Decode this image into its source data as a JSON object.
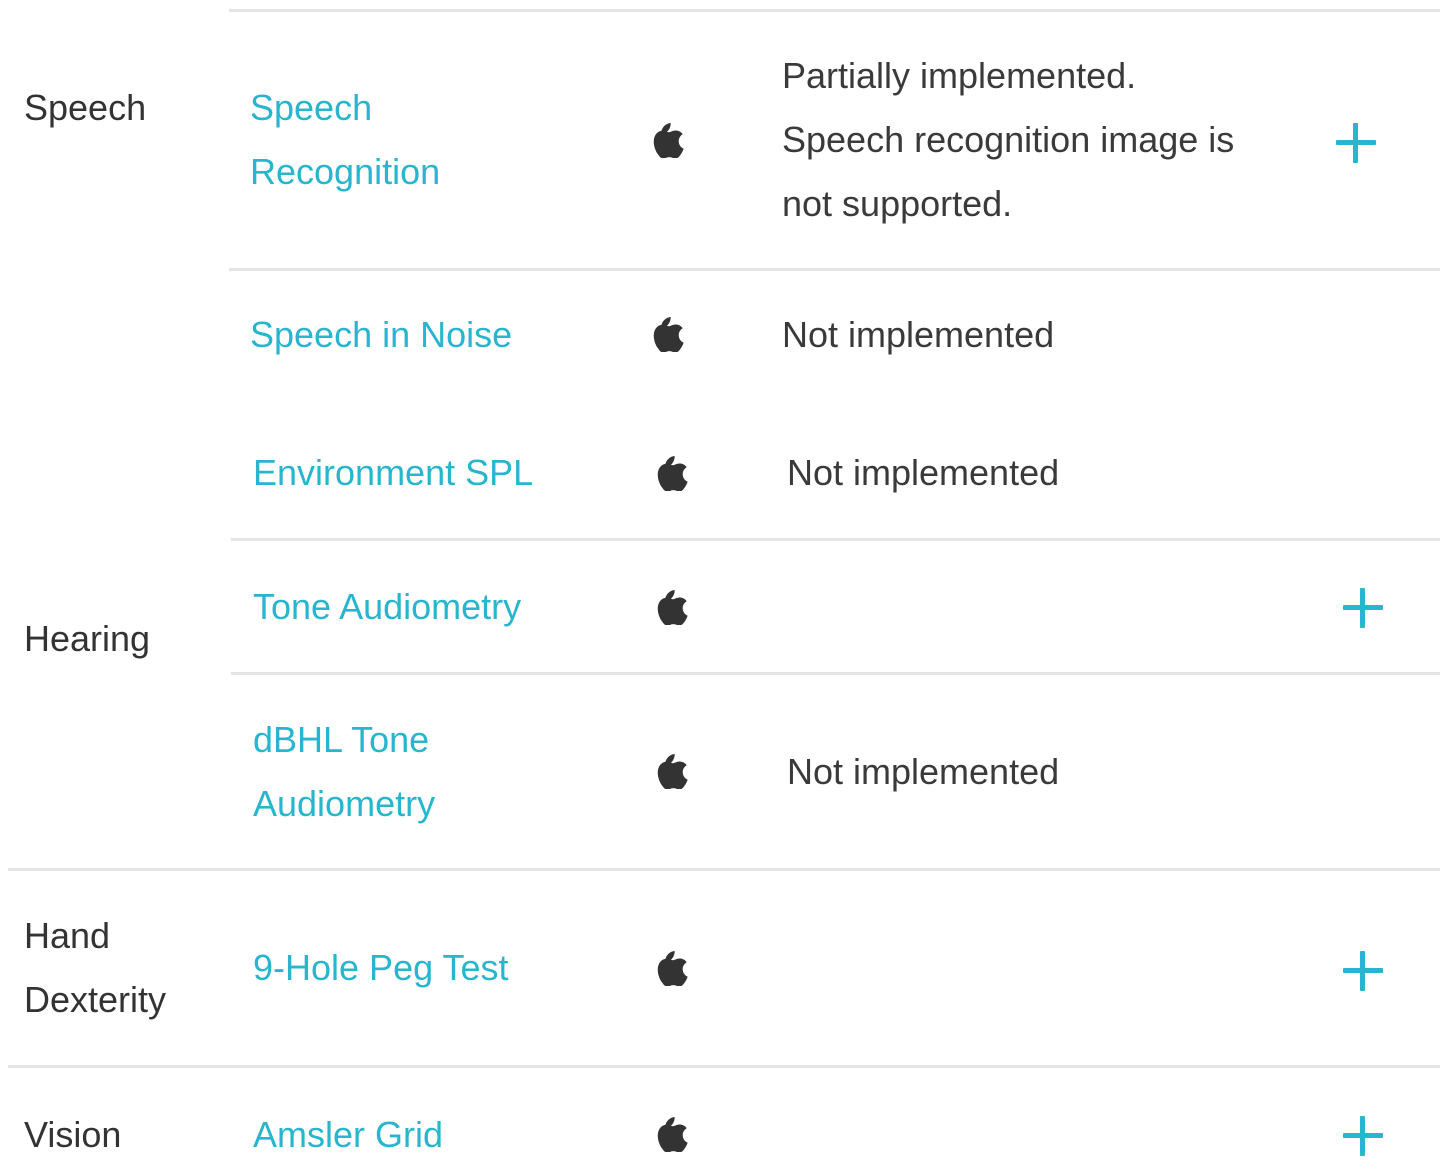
{
  "categories": {
    "speech": "Speech",
    "hearing": "Hearing",
    "hand_dexterity": "Hand Dexterity",
    "vision": "Vision"
  },
  "rows": [
    {
      "task": "Speech Recognition",
      "platform_icon": "apple-icon",
      "status": "Partially implemented. Speech recognition image is not supported.",
      "expandable": true
    },
    {
      "task": "Speech in Noise",
      "platform_icon": "apple-icon",
      "status": "Not implemented",
      "expandable": false
    },
    {
      "task": "Environment SPL",
      "platform_icon": "apple-icon",
      "status": "Not implemented",
      "expandable": false
    },
    {
      "task": "Tone Audiometry",
      "platform_icon": "apple-icon",
      "status": "",
      "expandable": true
    },
    {
      "task": "dBHL Tone Audiometry",
      "platform_icon": "apple-icon",
      "status": "Not implemented",
      "expandable": false
    },
    {
      "task": "9-Hole Peg Test",
      "platform_icon": "apple-icon",
      "status": "",
      "expandable": true
    },
    {
      "task": "Amsler Grid",
      "platform_icon": "apple-icon",
      "status": "",
      "expandable": true
    }
  ],
  "colors": {
    "link": "#27b6cd",
    "text": "#333333",
    "divider": "#e4e4e4",
    "icon": "#333333"
  }
}
